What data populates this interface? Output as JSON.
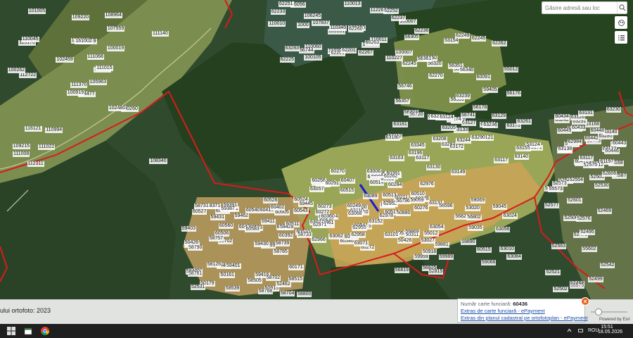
{
  "search": {
    "placeholder": "Găsire adresă sau loc",
    "icon": "search-icon"
  },
  "map_buttons": [
    {
      "icon": "basemap-icon"
    },
    {
      "icon": "list-icon"
    }
  ],
  "parcels": [
    "114477",
    "115170",
    "111370",
    "109215",
    "113964",
    "110994",
    "108964",
    "110449",
    "107559",
    "105963",
    "101005",
    "108340",
    "112722",
    "111140",
    "100919",
    "100019",
    "112311",
    "112485",
    "111068",
    "116121",
    "102459",
    "111008",
    "111022",
    "161002",
    "111015",
    "100260",
    "110045",
    "109220",
    "100262",
    "102480",
    "100007",
    "105101",
    "110201",
    "110345",
    "106245",
    "112265",
    "110060",
    "110227",
    "100007",
    "110011",
    "110013",
    "107837",
    "1000",
    "107418",
    "100105",
    "110010",
    "106250",
    "62225",
    "62201",
    "62260",
    "63283",
    "62237",
    "62233",
    "60263",
    "62267",
    "56744",
    "56056",
    "62251",
    "62201",
    "62252",
    "62249",
    "62270",
    "62245",
    "62250",
    "62262",
    "62236",
    "62245",
    "53154",
    "50407",
    "56357",
    "56359",
    "56321",
    "59405",
    "56320",
    "56303",
    "56305",
    "56361",
    "56746",
    "56351",
    "56741",
    "56340",
    "56720",
    "60091",
    "56176",
    "52047",
    "55012",
    "63239",
    "63129",
    "63127",
    "56178",
    "55174",
    "63171",
    "63121",
    "63117",
    "63244",
    "63140",
    "63112",
    "63149",
    "63124",
    "63236",
    "63345",
    "63138",
    "53124",
    "63180",
    "63196",
    "63117",
    "63130",
    "63290",
    "63175",
    "63208",
    "63155",
    "63181",
    "63133",
    "63293",
    "63297",
    "63163",
    "63172",
    "63261",
    "63205",
    "63124",
    "63181",
    "63230",
    "63168",
    "63291",
    "63285",
    "52651",
    "63168",
    "63211",
    "63140",
    "63242",
    "63130",
    "63160",
    "63128",
    "63126",
    "63131",
    "63127",
    "62984",
    "63138",
    "60443",
    "60433",
    "60445",
    "60449",
    "60446",
    "60442",
    "60448",
    "60434",
    "60478",
    "61197",
    "63117",
    "63131",
    "62976",
    "60407",
    "60409",
    "60500",
    "60510",
    "60528",
    "60517",
    "60514",
    "60515",
    "60522",
    "60513",
    "63080",
    "63057",
    "63006",
    "63043",
    "63021",
    "63089",
    "63131",
    "60270",
    "60276",
    "60278",
    "60283",
    "60397",
    "60391",
    "60284",
    "60249",
    "60262",
    "60211",
    "60256",
    "60291",
    "60272",
    "60385",
    "60272",
    "60290",
    "60273",
    "60304",
    "60360",
    "60540",
    "60546",
    "60541",
    "60534",
    "60528",
    "60520",
    "60515",
    "63152",
    "63071",
    "63095",
    "63110",
    "63101",
    "63062",
    "62961",
    "62919",
    "63068",
    "63027",
    "62978",
    "62971",
    "62955",
    "62966",
    "62958",
    "62952",
    "63084",
    "63024",
    "63054",
    "63010",
    "63056",
    "59989",
    "59959",
    "59890",
    "59881",
    "59869",
    "56596",
    "56821",
    "56819",
    "56802",
    "56825",
    "50916",
    "59035",
    "59045",
    "59059",
    "59066",
    "59069",
    "50880",
    "52815",
    "56796",
    "53027",
    "53020",
    "55012",
    "50311",
    "50426",
    "60515",
    "60543",
    "60511",
    "60528",
    "60527",
    "60426",
    "60533",
    "60510",
    "60537",
    "60415",
    "60505",
    "60521",
    "60506",
    "60524",
    "60577",
    "60392",
    "60402",
    "60560",
    "60583",
    "60540",
    "60450",
    "59428",
    "59411",
    "59403",
    "59445",
    "59462",
    "59391",
    "59387",
    "58371",
    "58731",
    "59431",
    "58702",
    "58699",
    "59405",
    "59407",
    "59404",
    "59400",
    "58704",
    "59401",
    "59430",
    "60171",
    "58126",
    "50426",
    "59416",
    "50179",
    "50915",
    "50161",
    "58505",
    "58515",
    "58539",
    "58702",
    "58733",
    "58761",
    "58800",
    "58757",
    "58785",
    "58788",
    "58790",
    "58739",
    "52531",
    "52462",
    "52470",
    "52503",
    "52530",
    "52521",
    "52412",
    "52563",
    "52577",
    "52468",
    "52495",
    "52469",
    "52546",
    "52560",
    "52601",
    "52575",
    "52502",
    "52500",
    "52499",
    "52573",
    "52587",
    "52606",
    "52554",
    "55602",
    "55575",
    "55573",
    "52576",
    "52542"
  ],
  "ortho_label": "ului ortofoto: 2023",
  "popup": {
    "label": "Număr carte funciară:",
    "value": "60436",
    "link1": "Extras de carte funciară - ePayment",
    "link2": "Extras din planul cadastral pe ortofotoplan - ePayment"
  },
  "attribution": "Powered by Esri",
  "taskbar": {
    "lang": "ROU",
    "time": "15:51",
    "date": "18.05.2026"
  },
  "colors": {
    "boundary": "#d81b1b",
    "forest": "#2c4a2a",
    "field": "#9aa85a",
    "water": "#3b5a45",
    "highlight": "#1a1ad8"
  }
}
